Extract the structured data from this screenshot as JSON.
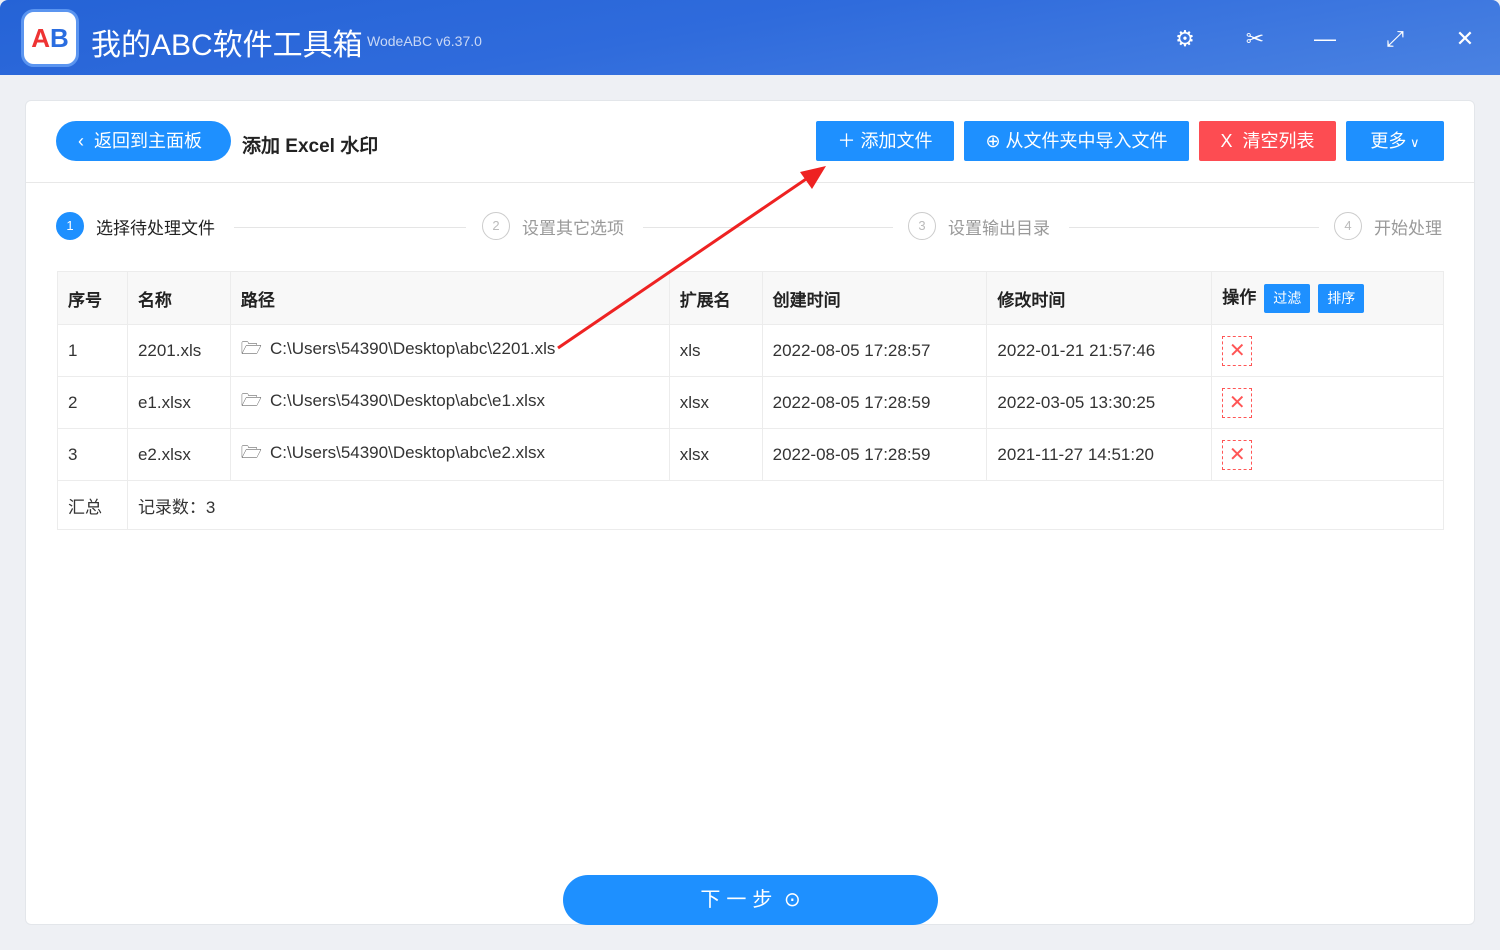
{
  "app": {
    "title": "我的ABC软件工具箱",
    "version": "WodeABC v6.37.0",
    "logo_text": "AB"
  },
  "window": {
    "settings": "⚙",
    "tools": "✂",
    "minimize": "—",
    "maximize": "⤢",
    "close": "✕"
  },
  "header": {
    "back_label": "返回到主面板",
    "page_title": "添加 Excel 水印",
    "add_file": "添加文件",
    "import_folder": "从文件夹中导入文件",
    "clear_list": "清空列表",
    "more": "更多"
  },
  "steps": [
    {
      "num": "1",
      "label": "选择待处理文件"
    },
    {
      "num": "2",
      "label": "设置其它选项"
    },
    {
      "num": "3",
      "label": "设置输出目录"
    },
    {
      "num": "4",
      "label": "开始处理"
    }
  ],
  "table": {
    "headers": [
      "序号",
      "名称",
      "路径",
      "扩展名",
      "创建时间",
      "修改时间",
      "操作"
    ],
    "filter": "过滤",
    "sort": "排序",
    "rows": [
      {
        "idx": "1",
        "name": "2201.xls",
        "path": "C:\\Users\\54390\\Desktop\\abc\\2201.xls",
        "ext": "xls",
        "created": "2022-08-05 17:28:57",
        "modified": "2022-01-21 21:57:46"
      },
      {
        "idx": "2",
        "name": "e1.xlsx",
        "path": "C:\\Users\\54390\\Desktop\\abc\\e1.xlsx",
        "ext": "xlsx",
        "created": "2022-08-05 17:28:59",
        "modified": "2022-03-05 13:30:25"
      },
      {
        "idx": "3",
        "name": "e2.xlsx",
        "path": "C:\\Users\\54390\\Desktop\\abc\\e2.xlsx",
        "ext": "xlsx",
        "created": "2022-08-05 17:28:59",
        "modified": "2021-11-27 14:51:20"
      }
    ],
    "summary_label": "汇总",
    "summary_value": "记录数：3"
  },
  "footer": {
    "next": "下一步"
  },
  "colors": {
    "accent": "#1e90ff",
    "danger": "#fd4c52",
    "arrow": "#ee2222"
  }
}
